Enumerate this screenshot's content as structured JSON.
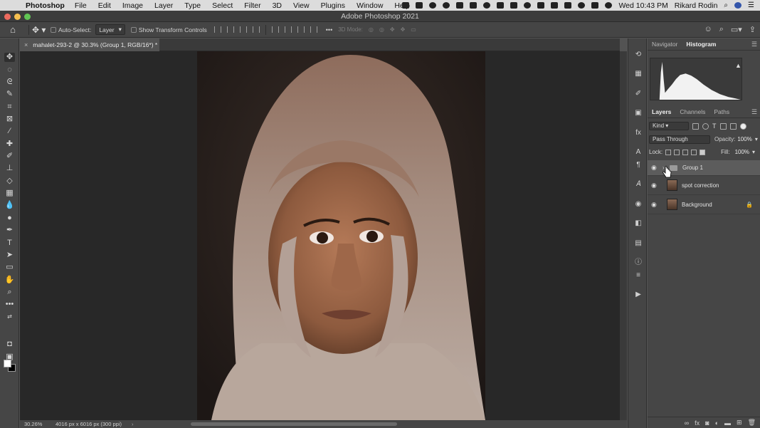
{
  "menubar": {
    "app_name": "Photoshop",
    "items": [
      "File",
      "Edit",
      "Image",
      "Layer",
      "Type",
      "Select",
      "Filter",
      "3D",
      "View",
      "Plugins",
      "Window",
      "Help"
    ],
    "clock": "Wed 10:43 PM",
    "user": "Rikard Rodin"
  },
  "window": {
    "title": "Adobe Photoshop 2021"
  },
  "options": {
    "auto_select_label": "Auto-Select:",
    "auto_select_value": "Layer",
    "transform_label": "Show Transform Controls",
    "mode_3d": "3D Mode:"
  },
  "document": {
    "tab_label": "mahalet-293-2 @ 30.3% (Group 1, RGB/16*) *",
    "zoom": "30.26%",
    "dimensions": "4016 px x 6016 px (300 ppi)"
  },
  "top_panel": {
    "tabs": [
      "Navigator",
      "Histogram"
    ],
    "active": "Histogram"
  },
  "layers_panel": {
    "tabs": [
      "Layers",
      "Channels",
      "Paths"
    ],
    "filter": "Kind",
    "blend_mode": "Pass Through",
    "opacity_label": "Opacity:",
    "opacity": "100%",
    "lock_label": "Lock:",
    "fill_label": "Fill:",
    "fill": "100%",
    "layers": [
      {
        "name": "Group 1",
        "type": "group",
        "selected": true
      },
      {
        "name": "spot correction",
        "type": "pixel",
        "selected": false
      },
      {
        "name": "Background",
        "type": "pixel",
        "locked": true,
        "selected": false
      }
    ]
  },
  "colors": {
    "panel_bg": "#464646",
    "canvas_bg": "#282828",
    "selected_layer": "#5c5c5c"
  }
}
